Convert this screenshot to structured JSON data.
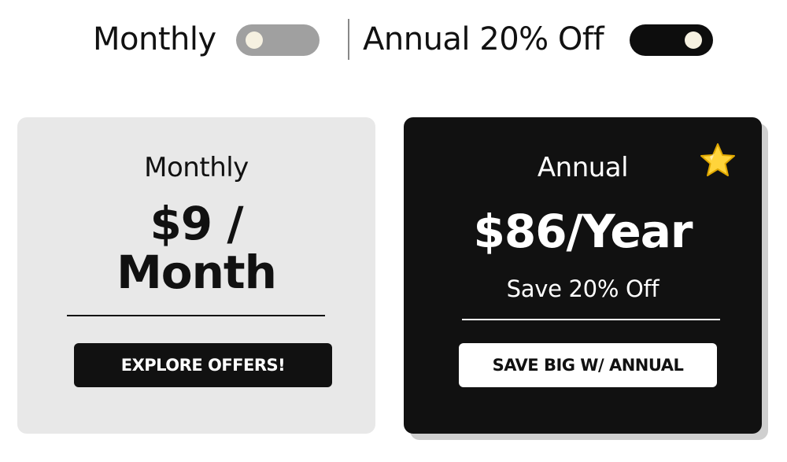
{
  "billing_toggle": {
    "monthly_label": "Monthly",
    "annual_label": "Annual 20% Off",
    "selected": "annual"
  },
  "plans": [
    {
      "title": "Monthly",
      "price_line1": "$9 /",
      "price_line2": "Month",
      "cta_label": "EXPLORE OFFERS!"
    },
    {
      "title": "Annual",
      "price": "$86/Year",
      "subtitle": "Save 20% Off",
      "cta_label": "SAVE BIG W/ ANNUAL",
      "badge_icon": "star-icon"
    }
  ],
  "colors": {
    "dark": "#111111",
    "light_card": "#e8e8e8",
    "switch_off": "#a0a0a0",
    "knob": "#f6f1e1",
    "star": "#ffd43b"
  }
}
